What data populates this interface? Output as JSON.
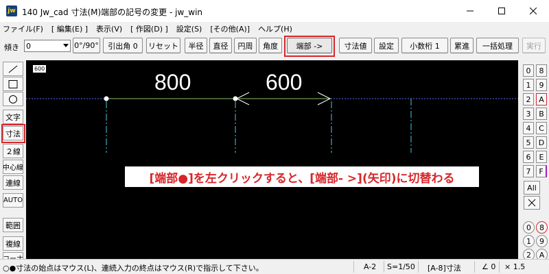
{
  "window": {
    "icon_text": "jw",
    "title": "140 Jw_cad 寸法(M)端部の記号の変更 - jw_win"
  },
  "menu": [
    "ファイル(F)",
    "[ 編集(E) ]",
    "表示(V)",
    "[ 作図(D) ]",
    "設定(S)",
    "[その他(A)]",
    "ヘルプ(H)"
  ],
  "toolbar": {
    "tilt_label": "傾き",
    "tilt_value": "0",
    "angle_button": "0°/90°",
    "leader_button": "引出角 0",
    "reset_button": "リセット",
    "radius_button": "半径",
    "diameter_button": "直径",
    "circumference_button": "円周",
    "angle_dim_button": "角度",
    "endpoint_button": "端部 ->",
    "dim_value_button": "寸法値",
    "settings_button": "設定",
    "decimal_button": "小数桁 1",
    "cumulative_button": "累進",
    "batch_button": "一括処理",
    "execute_button": "実行"
  },
  "left_tools": [
    {
      "name": "line-tool",
      "label": ""
    },
    {
      "name": "rectangle-tool",
      "label": ""
    },
    {
      "name": "circle-tool",
      "label": ""
    },
    {
      "name": "text-tool",
      "label": "文字"
    },
    {
      "name": "dimension-tool",
      "label": "寸法"
    },
    {
      "name": "double-line-tool",
      "label": "２線"
    },
    {
      "name": "center-line-tool",
      "label": "中心線"
    },
    {
      "name": "continuous-line-tool",
      "label": "連線"
    },
    {
      "name": "auto-tool",
      "label": "AUTO"
    },
    {
      "name": "range-tool",
      "label": "範囲"
    },
    {
      "name": "copy-tool",
      "label": "複線"
    },
    {
      "name": "corner-tool",
      "label": "コーナ"
    }
  ],
  "canvas": {
    "layer_badge": "600",
    "dimension_values": [
      "800",
      "600"
    ],
    "annotation": "[端部●]を左クリックすると、[端部- >](矢印)に切替わる"
  },
  "layers": {
    "left_column": [
      "0",
      "1",
      "2",
      "3",
      "4",
      "5",
      "6",
      "7"
    ],
    "right_column": [
      "8",
      "9",
      "A",
      "B",
      "C",
      "D",
      "E",
      "F"
    ],
    "all_button": "All",
    "group_left": [
      "0",
      "1",
      "2"
    ],
    "group_right": [
      "8",
      "9",
      "A"
    ]
  },
  "status": {
    "message": "○●寸法の始点はマウス(L)、連続入力の終点はマウス(R)で指示して下さい。",
    "paper": "A-2",
    "scale": "S=1/50",
    "layer": "[A-8]寸法",
    "angle": "∠ 0",
    "zoom": "× 1.5"
  },
  "colors": {
    "highlight": "#d7262a",
    "canvas_bg": "#000000",
    "guide_line": "#4f6dff",
    "dim_line": "#86c36b",
    "extension_line": "#4ec9e0"
  }
}
